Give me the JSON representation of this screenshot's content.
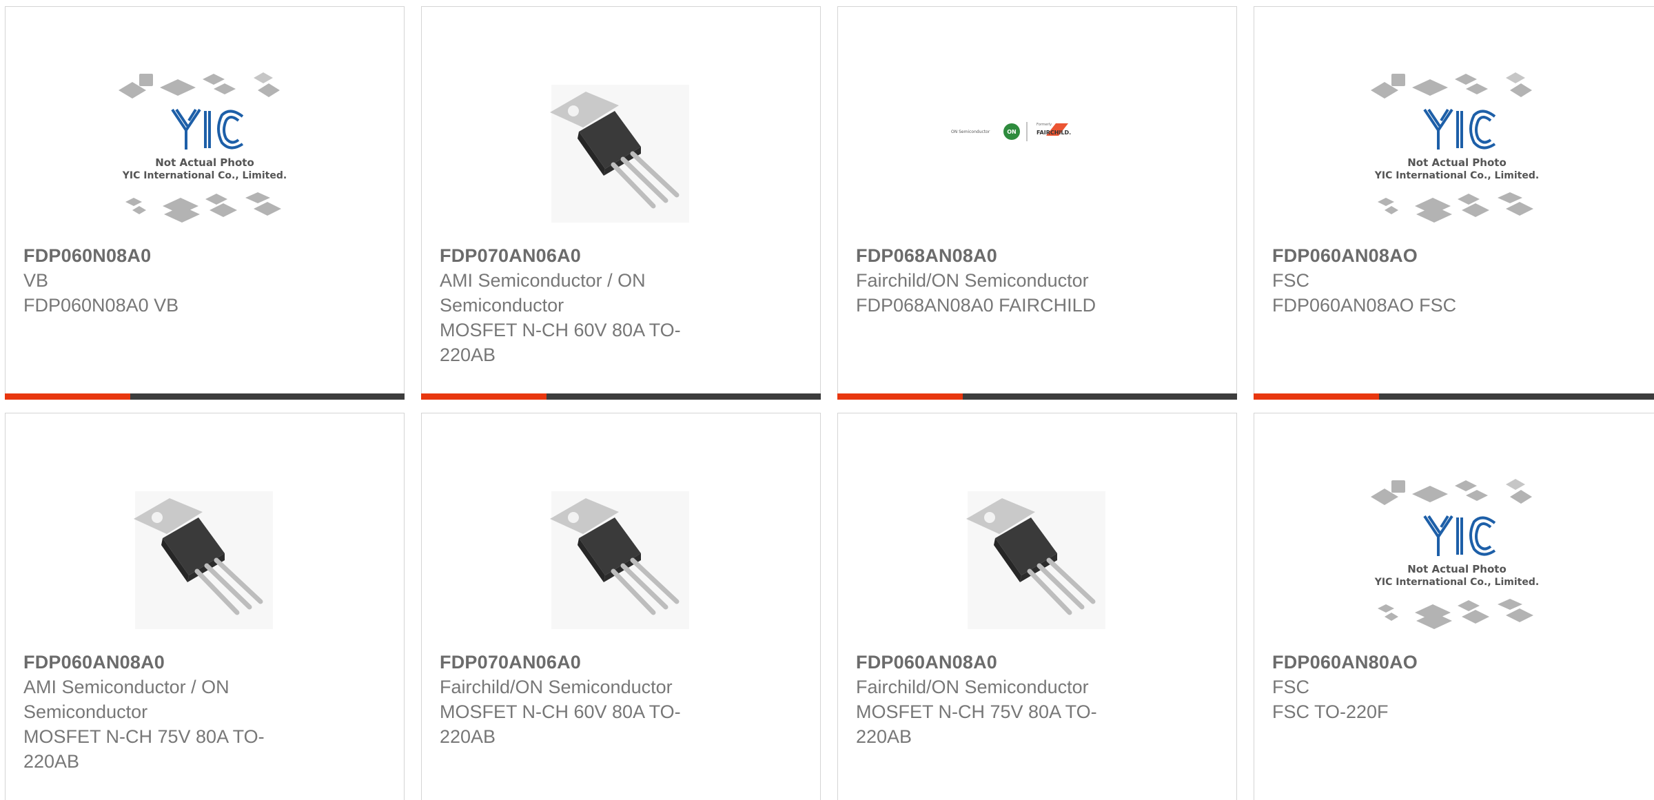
{
  "products": [
    {
      "part": "FDP060N08A0",
      "lines": [
        "VB",
        "FDP060N08A0 VB"
      ],
      "image": "yic-placeholder-image"
    },
    {
      "part": "FDP070AN06A0",
      "lines": [
        "AMI Semiconductor / ON",
        "Semiconductor",
        "MOSFET N-CH 60V 80A TO-",
        "220AB"
      ],
      "image": "to220-transistor-image"
    },
    {
      "part": "FDP068AN08A0",
      "lines": [
        "Fairchild/ON Semiconductor",
        "FDP068AN08A0 FAIRCHILD"
      ],
      "image": "on-semi-fairchild-logo"
    },
    {
      "part": "FDP060AN08AO",
      "lines": [
        "FSC",
        "FDP060AN08AO FSC"
      ],
      "image": "yic-placeholder-image"
    },
    {
      "part": "FDP060AN08A0",
      "lines": [
        "AMI Semiconductor / ON",
        "Semiconductor",
        "MOSFET N-CH 75V 80A TO-",
        "220AB"
      ],
      "image": "to220-transistor-image"
    },
    {
      "part": "FDP070AN06A0",
      "lines": [
        "Fairchild/ON Semiconductor",
        "MOSFET N-CH 60V 80A TO-",
        "220AB"
      ],
      "image": "to220-transistor-image"
    },
    {
      "part": "FDP060AN08A0",
      "lines": [
        "Fairchild/ON Semiconductor",
        "MOSFET N-CH 75V 80A TO-",
        "220AB"
      ],
      "image": "to220-transistor-image"
    },
    {
      "part": "FDP060AN80AO",
      "lines": [
        "FSC",
        "FSC TO-220F"
      ],
      "image": "yic-placeholder-image"
    }
  ],
  "placeholder": {
    "logo_text": "YIC",
    "caption_line1": "Not Actual Photo",
    "caption_line2": "YIC International Co., Limited."
  },
  "brand_logo": {
    "left_text": "ON Semiconductor",
    "badge_text": "ON",
    "formerly_text": "Formerly",
    "right_text": "FAIRCHILD."
  },
  "colors": {
    "accent": "#e8370f",
    "bar": "#3d3d3d",
    "title_text": "#6b6b6b",
    "body_text": "#777777",
    "border": "#d4d4d4",
    "yic_blue": "#1d5fa8"
  }
}
